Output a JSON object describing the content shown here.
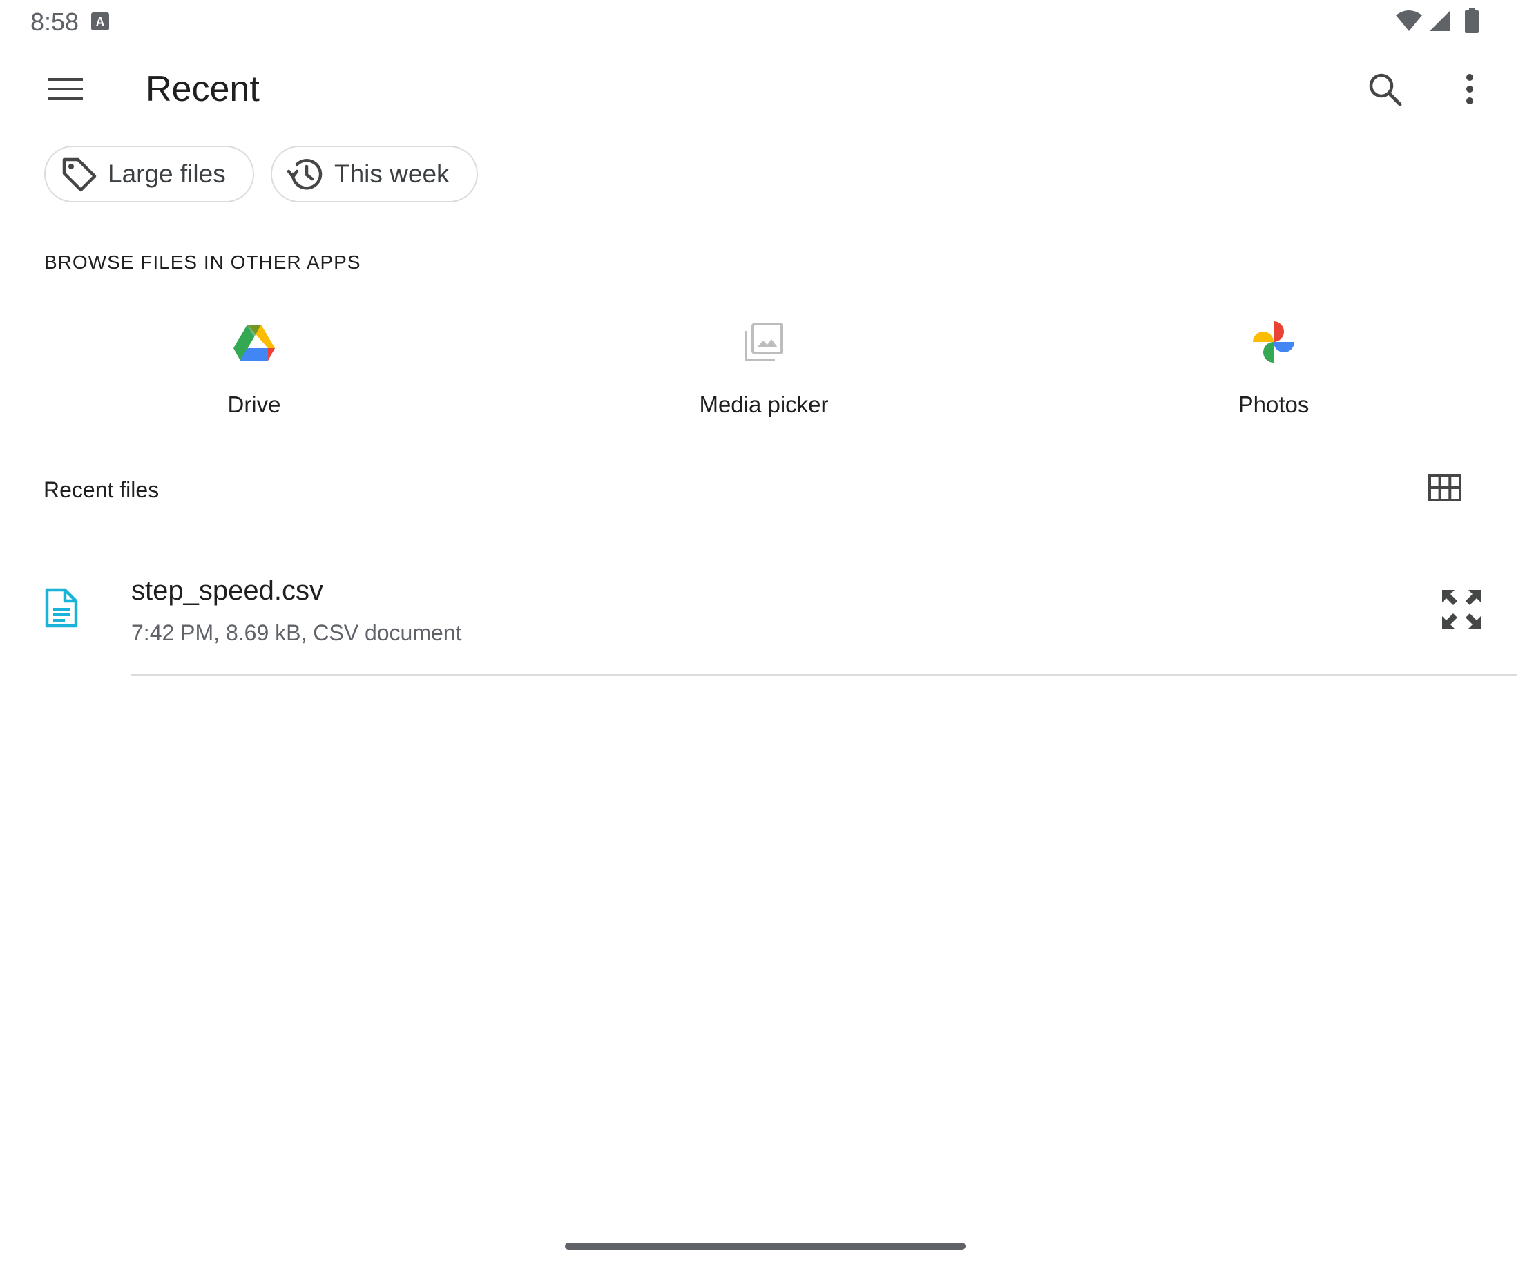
{
  "status_bar": {
    "time": "8:58",
    "left_icons": [
      "keyboard-a-icon"
    ],
    "right_icons": [
      "wifi-icon",
      "signal-icon",
      "battery-icon"
    ]
  },
  "app_bar": {
    "title": "Recent",
    "icons": [
      "menu-icon",
      "search-icon",
      "more-vert-icon"
    ]
  },
  "chips": [
    {
      "label": "Large files",
      "icon": "tag-icon"
    },
    {
      "label": "This week",
      "icon": "history-icon"
    }
  ],
  "browse_section": {
    "header": "BROWSE FILES IN OTHER APPS",
    "apps": [
      {
        "label": "Drive",
        "icon": "google-drive-icon"
      },
      {
        "label": "Media picker",
        "icon": "photo-library-icon"
      },
      {
        "label": "Photos",
        "icon": "google-photos-icon"
      }
    ]
  },
  "recent_files": {
    "header": "Recent files",
    "view_toggle_icon": "grid-view-icon",
    "files": [
      {
        "name": "step_speed.csv",
        "meta": "7:42 PM, 8.69 kB, CSV document",
        "icon": "document-icon",
        "action_icon": "fullscreen-icon"
      }
    ]
  },
  "colors": {
    "text_primary": "#1f1f1f",
    "text_secondary": "#5f6368",
    "icon_gray": "#444746",
    "divider": "#dadce0",
    "doc_icon": "#1ab3d8",
    "media_icon": "#bdbdbd"
  }
}
